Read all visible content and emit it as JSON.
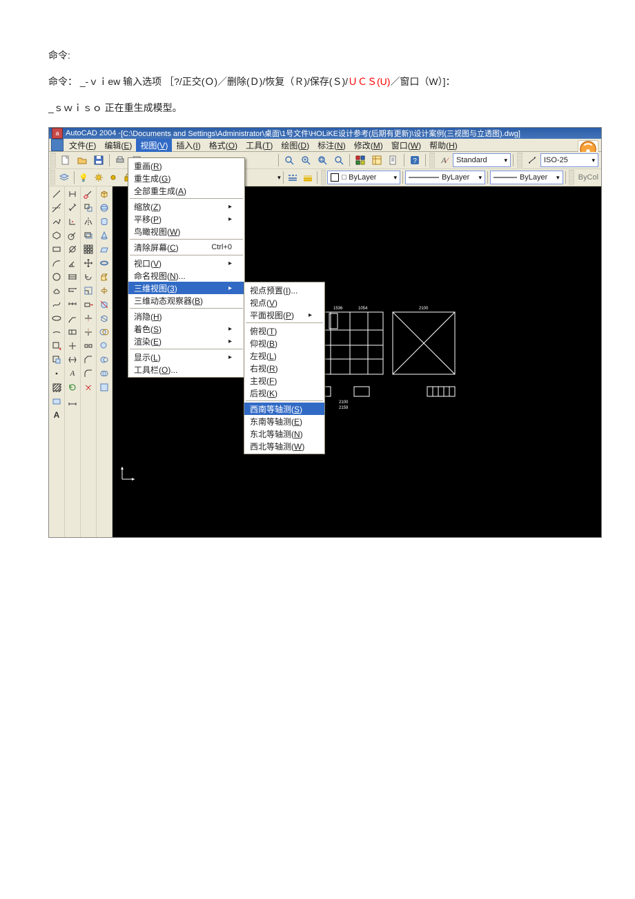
{
  "doc": {
    "line1": "命令:",
    "line2_prefix": "命令：  _-ｖｉew 输入选项 ［?/正交(Ｏ)／删除(Ｄ)/恢复（Ｒ)/保存(Ｓ)/",
    "line2_ucs": "ＵＣＳ(U)",
    "line2_suffix": "／窗口（W）]：",
    "line3": "_ｓｗｉｓｏ  正在重生成模型。"
  },
  "titlebar": {
    "app_prefix": "AutoCAD 2004 - ",
    "doc_title": "[C:\\Documents and Settings\\Administrator\\桌面\\1号文件\\HOLiKE设计参考(后期有更新)\\设计案例(三视图与立透图).dwg]",
    "icon_letter": "a"
  },
  "menubar": {
    "items": [
      {
        "label": "文件(F)",
        "hot": false,
        "u": "F"
      },
      {
        "label": "编辑(E)",
        "hot": false,
        "u": "E"
      },
      {
        "label": "视图(V)",
        "hot": true,
        "u": "V"
      },
      {
        "label": "插入(I)",
        "hot": false,
        "u": "I"
      },
      {
        "label": "格式(O)",
        "hot": false,
        "u": "O"
      },
      {
        "label": "工具(T)",
        "hot": false,
        "u": "T"
      },
      {
        "label": "绘图(D)",
        "hot": false,
        "u": "D"
      },
      {
        "label": "标注(N)",
        "hot": false,
        "u": "N"
      },
      {
        "label": "修改(M)",
        "hot": false,
        "u": "M"
      },
      {
        "label": "窗口(W)",
        "hot": false,
        "u": "W"
      },
      {
        "label": "帮助(H)",
        "hot": false,
        "u": "H"
      }
    ]
  },
  "toolbar1": {
    "style_text": "Standard",
    "dim_text": "ISO-25"
  },
  "toolbar2": {
    "layer_field": "□ ByLayer",
    "bylayer_a": "ByLayer",
    "bylayer_b": "ByLayer",
    "bycol": "ByCol"
  },
  "view_menu": {
    "r1": "重画(R)",
    "r1u": "R",
    "r2": "重生成(G)",
    "r2u": "G",
    "r3": "全部重生成(A)",
    "r3u": "A",
    "r4": "缩放(Z)",
    "r4u": "Z",
    "r5": "平移(P)",
    "r5u": "P",
    "r6": "鸟瞰视图(W)",
    "r6u": "W",
    "r7": "清除屏幕(C)",
    "r7u": "C",
    "r7sc": "Ctrl+0",
    "r8": "视口(V)",
    "r8u": "V",
    "r9": "命名视图(N)...",
    "r9u": "N",
    "r10": "三维视图(3)",
    "r10u": "3",
    "r11": "三维动态观察器(B)",
    "r11u": "B",
    "r12": "消隐(H)",
    "r12u": "H",
    "r13": "着色(S)",
    "r13u": "S",
    "r14": "渲染(E)",
    "r14u": "E",
    "r15": "显示(L)",
    "r15u": "L",
    "r16": "工具栏(O)...",
    "r16u": "O"
  },
  "sub_menu": {
    "s1": "视点预置(I)...",
    "s1u": "I",
    "s2": "视点(V)",
    "s2u": "V",
    "s3": "平面视图(P)",
    "s3u": "P",
    "s4": "俯视(T)",
    "s4u": "T",
    "s5": "仰视(B)",
    "s5u": "B",
    "s6": "左视(L)",
    "s6u": "L",
    "s7": "右视(R)",
    "s7u": "R",
    "s8": "主视(F)",
    "s8u": "F",
    "s9": "后视(K)",
    "s9u": "K",
    "s10": "西南等轴测(S)",
    "s10u": "S",
    "s11": "东南等轴测(E)",
    "s11u": "E",
    "s12": "东北等轴测(N)",
    "s12u": "N",
    "s13": "西北等轴测(W)",
    "s13u": "W"
  },
  "drawing_labels": {
    "d1": "1536",
    "d2": "1054",
    "d3": "2100",
    "d4": "2100",
    "d5": "2159"
  }
}
